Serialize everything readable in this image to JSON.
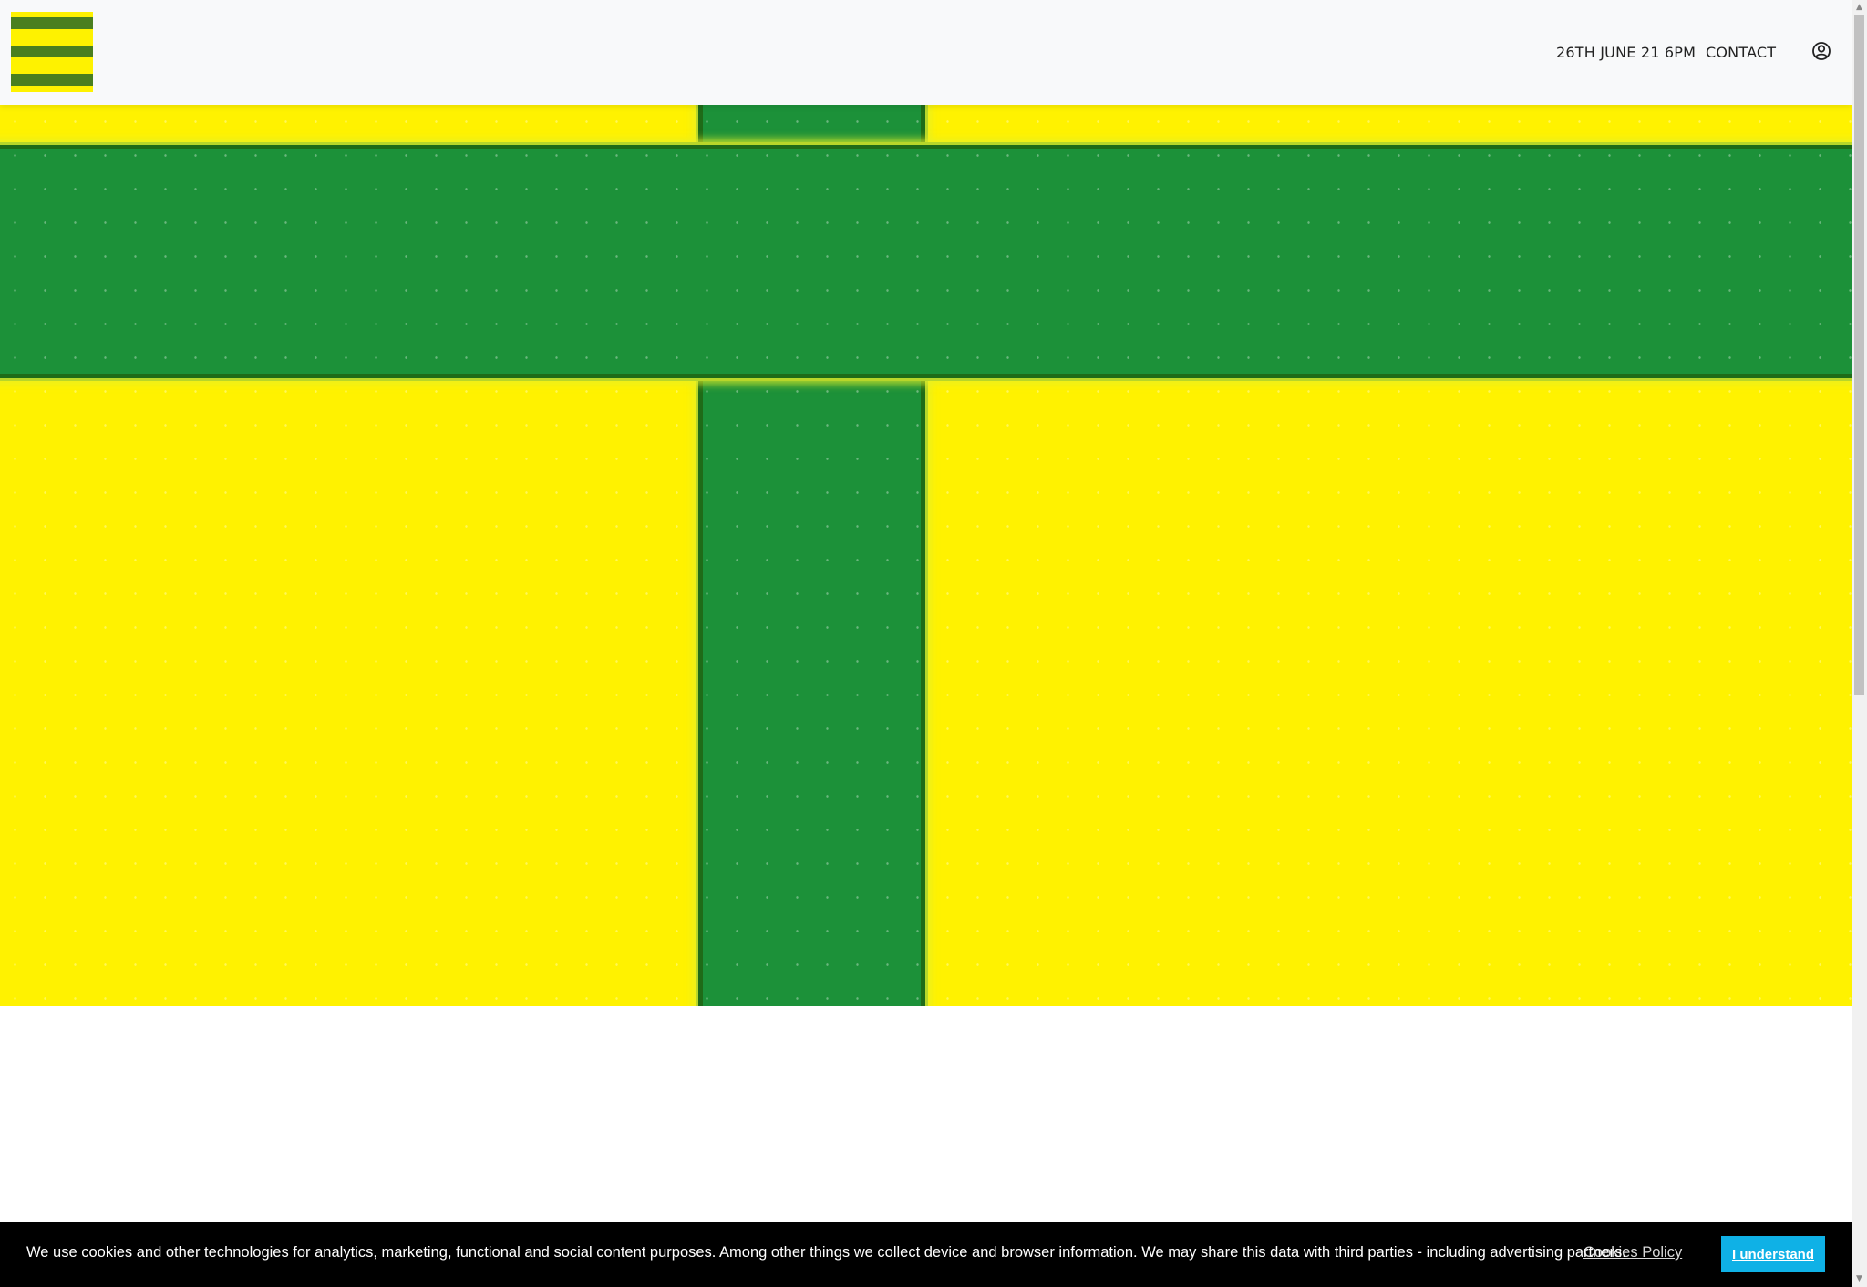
{
  "header": {
    "logo_name": "striped-logo",
    "nav": [
      {
        "label": "26TH JUNE 21 6PM"
      },
      {
        "label": "CONTACT"
      }
    ],
    "account_icon": "user-circle-icon"
  },
  "hero": {
    "colors": {
      "background": "#fff200",
      "band": "#1c9139",
      "band_edge": "#1f6b18"
    }
  },
  "cookie_banner": {
    "text": "We use cookies and other technologies for analytics, marketing, functional and social content purposes. Among other things we collect device and browser information. We may share this data with third parties - including advertising partners.",
    "policy_link": "Cookies Policy",
    "accept_button": "I understand",
    "accent_color": "#0fb1e6"
  }
}
